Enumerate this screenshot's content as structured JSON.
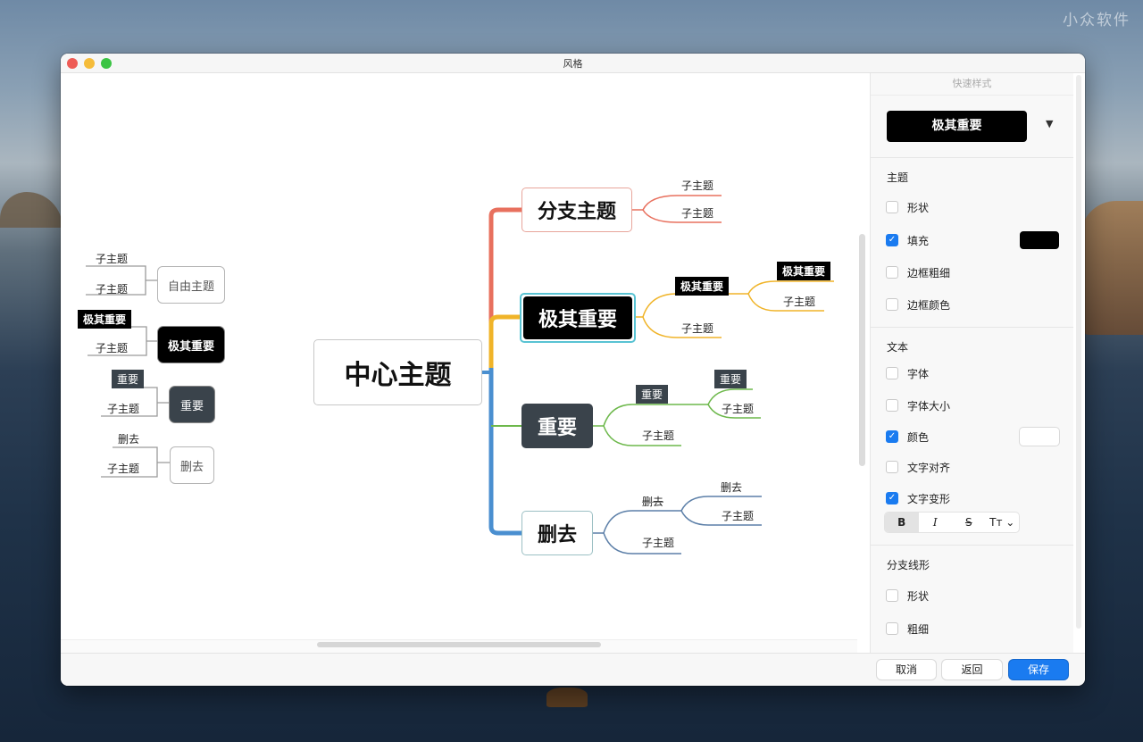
{
  "desktop": {
    "watermark": "小众软件"
  },
  "window": {
    "title": "风格"
  },
  "mindmap": {
    "center": "中心主题",
    "branches": [
      {
        "label": "分支主题",
        "color": "#e8705e",
        "children": [
          "子主题",
          "子主题"
        ]
      },
      {
        "label": "极其重要",
        "color": "#f0b429",
        "children": [
          {
            "label": "极其重要",
            "style": "black-tag",
            "children": [
              {
                "label": "极其重要",
                "style": "black-tag"
              },
              {
                "label": "子主题"
              }
            ]
          },
          {
            "label": "子主题"
          }
        ]
      },
      {
        "label": "重要",
        "color": "#6db84b",
        "children": [
          {
            "label": "重要",
            "style": "gray-tag",
            "children": [
              {
                "label": "重要",
                "style": "gray-tag"
              },
              {
                "label": "子主题"
              }
            ]
          },
          {
            "label": "子主题"
          }
        ]
      },
      {
        "label": "删去",
        "color": "#4a8fd0",
        "children": [
          {
            "label": "删去",
            "children": [
              {
                "label": "删去"
              },
              {
                "label": "子主题"
              }
            ]
          },
          {
            "label": "子主题"
          }
        ]
      }
    ],
    "legend": [
      {
        "node": "自由主题",
        "children": [
          "子主题",
          "子主题"
        ]
      },
      {
        "node": "极其重要",
        "children": [
          "极其重要",
          "子主题"
        ]
      },
      {
        "node": "重要",
        "children": [
          "重要",
          "子主题"
        ]
      },
      {
        "node": "删去",
        "children": [
          "删去",
          "子主题"
        ]
      }
    ]
  },
  "sidebar": {
    "header": "快速样式",
    "quick_style": "极其重要",
    "dropdown_icon": "▼",
    "sections": [
      {
        "title": "主题",
        "options": [
          {
            "label": "形状",
            "checked": false
          },
          {
            "label": "填充",
            "checked": true,
            "swatch": "#000000"
          },
          {
            "label": "边框粗细",
            "checked": false
          },
          {
            "label": "边框颜色",
            "checked": false
          }
        ]
      },
      {
        "title": "文本",
        "options": [
          {
            "label": "字体",
            "checked": false
          },
          {
            "label": "字体大小",
            "checked": false
          },
          {
            "label": "颜色",
            "checked": true,
            "swatch": "#ffffff"
          },
          {
            "label": "文字对齐",
            "checked": false
          },
          {
            "label": "文字变形",
            "checked": true
          }
        ]
      },
      {
        "title": "分支线形",
        "options": [
          {
            "label": "形状",
            "checked": false
          },
          {
            "label": "粗细",
            "checked": false
          }
        ]
      }
    ],
    "format_buttons": {
      "bold": "B",
      "italic": "I",
      "strike": "S",
      "case": "Tт ⌄"
    }
  },
  "footer": {
    "cancel": "取消",
    "back": "返回",
    "save": "保存"
  }
}
